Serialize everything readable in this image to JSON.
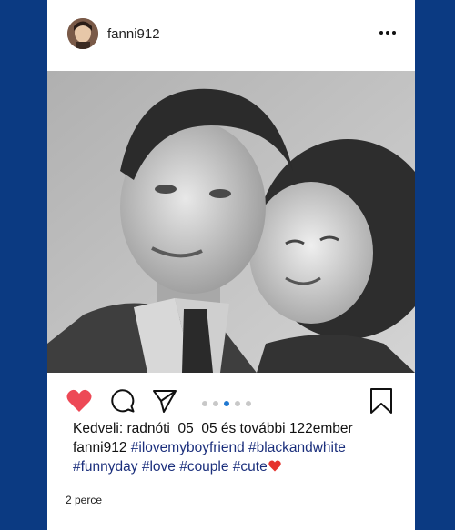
{
  "post": {
    "username": "fanni912",
    "likes_text": "Kedveli: radnóti_05_05 és további 122ember",
    "caption_user": "fanni912",
    "hashtags_line1": "#ilovemyboyfriend #blackandwhite",
    "hashtags_line2": "#funnyday #love #couple #cute",
    "time": "2 perce",
    "carousel": {
      "count": 5,
      "active_index": 3
    }
  },
  "icons": {
    "more": "more-dots-icon",
    "like": "heart-icon",
    "comment": "comment-icon",
    "share": "send-icon",
    "save": "bookmark-icon",
    "caption_end": "red-heart-icon"
  },
  "colors": {
    "background": "#0b3a82",
    "card": "#ffffff",
    "like": "#ed4956",
    "hashtag": "#1b2f7c",
    "carousel_active": "#1f78d1",
    "carousel_inactive": "#c8c8c8"
  }
}
